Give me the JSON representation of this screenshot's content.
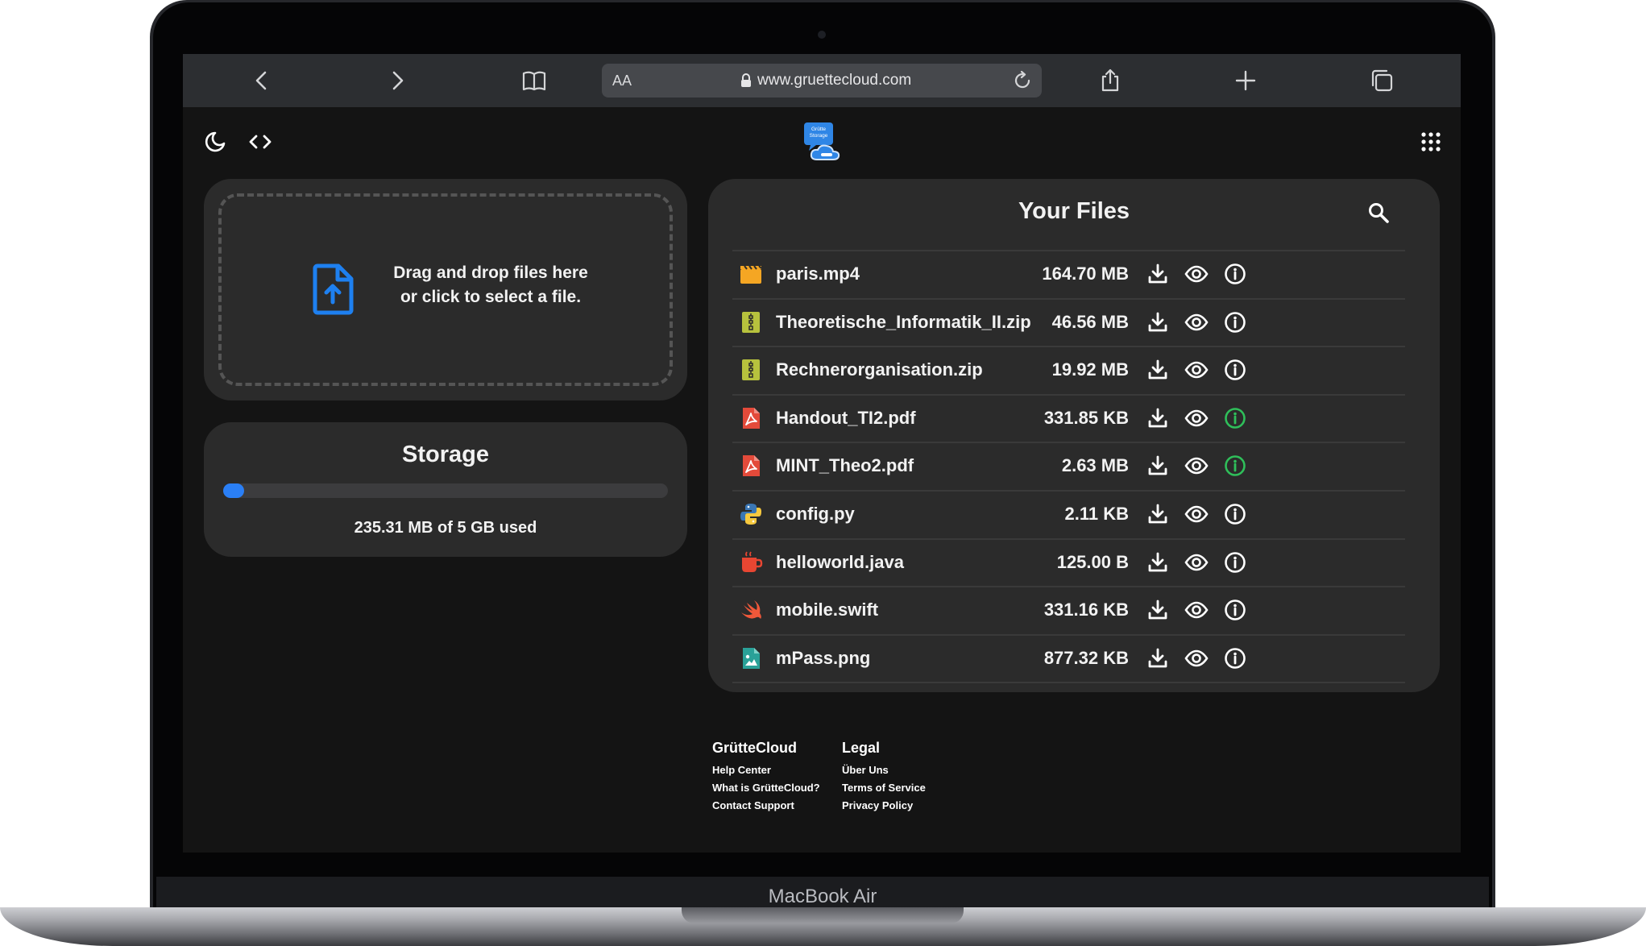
{
  "device": {
    "label": "MacBook Air"
  },
  "browser": {
    "aa_label": "AA",
    "url": "www.gruettecloud.com"
  },
  "logo": {
    "text": "Grütte Storage"
  },
  "upload": {
    "line1": "Drag and drop files here",
    "line2": "or click to select a file."
  },
  "storage": {
    "title": "Storage",
    "used_text": "235.31 MB of 5 GB used",
    "used_fraction": 0.046
  },
  "files": {
    "title": "Your Files",
    "items": [
      {
        "name": "paris.mp4",
        "size": "164.70 MB",
        "type": "video",
        "info_color": "#ffffff"
      },
      {
        "name": "Theoretische_Informatik_II.zip",
        "size": "46.56 MB",
        "type": "zip",
        "info_color": "#ffffff"
      },
      {
        "name": "Rechnerorganisation.zip",
        "size": "19.92 MB",
        "type": "zip",
        "info_color": "#ffffff"
      },
      {
        "name": "Handout_TI2.pdf",
        "size": "331.85 KB",
        "type": "pdf",
        "info_color": "#2fbf5a"
      },
      {
        "name": "MINT_Theo2.pdf",
        "size": "2.63 MB",
        "type": "pdf",
        "info_color": "#2fbf5a"
      },
      {
        "name": "config.py",
        "size": "2.11 KB",
        "type": "python",
        "info_color": "#ffffff"
      },
      {
        "name": "helloworld.java",
        "size": "125.00 B",
        "type": "java",
        "info_color": "#ffffff"
      },
      {
        "name": "mobile.swift",
        "size": "331.16 KB",
        "type": "swift",
        "info_color": "#ffffff"
      },
      {
        "name": "mPass.png",
        "size": "877.32 KB",
        "type": "image",
        "info_color": "#ffffff"
      }
    ]
  },
  "footer": {
    "col1": {
      "title": "GrütteCloud",
      "links": [
        "Help Center",
        "What is GrütteCloud?",
        "Contact Support"
      ]
    },
    "col2": {
      "title": "Legal",
      "links": [
        "Über Uns",
        "Terms of Service",
        "Privacy Policy"
      ]
    }
  },
  "colors": {
    "accent": "#2a7ff6",
    "background": "#141414",
    "card": "#2b2b2b"
  }
}
